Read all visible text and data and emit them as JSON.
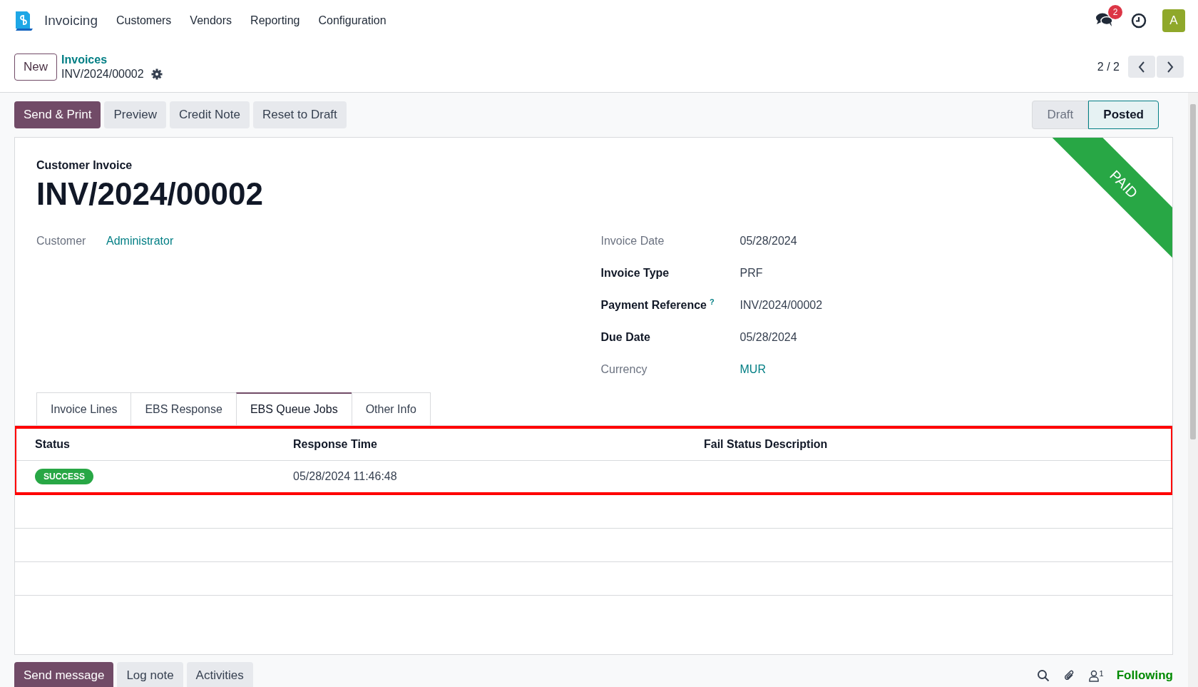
{
  "app_nav": {
    "app_name": "Invoicing",
    "menu": [
      "Customers",
      "Vendors",
      "Reporting",
      "Configuration"
    ],
    "messages_badge": "2",
    "avatar_letter": "A"
  },
  "control_panel": {
    "new_button": "New",
    "breadcrumb_parent": "Invoices",
    "breadcrumb_current": "INV/2024/00002",
    "pager": "2 / 2"
  },
  "actions": [
    {
      "label": "Send & Print",
      "kind": "primary"
    },
    {
      "label": "Preview",
      "kind": "secondary"
    },
    {
      "label": "Credit Note",
      "kind": "secondary"
    },
    {
      "label": "Reset to Draft",
      "kind": "secondary"
    }
  ],
  "status_bar": [
    {
      "label": "Draft",
      "selected": false
    },
    {
      "label": "Posted",
      "selected": true
    }
  ],
  "sheet": {
    "ribbon": "PAID",
    "subtitle": "Customer Invoice",
    "title": "INV/2024/00002",
    "customer": {
      "label": "Customer",
      "value": "Administrator"
    },
    "fields": [
      {
        "label": "Invoice Date",
        "value": "05/28/2024",
        "required": false,
        "link": false
      },
      {
        "label": "Invoice Type",
        "value": "PRF",
        "required": true,
        "link": false
      },
      {
        "label": "Payment Reference",
        "help": "?",
        "value": "INV/2024/00002",
        "required": true,
        "link": false
      },
      {
        "label": "Due Date",
        "value": "05/28/2024",
        "required": true,
        "link": false
      },
      {
        "label": "Currency",
        "value": "MUR",
        "required": false,
        "link": true
      }
    ]
  },
  "tabs": [
    {
      "label": "Invoice Lines",
      "selected": false
    },
    {
      "label": "EBS Response",
      "selected": false
    },
    {
      "label": "EBS Queue Jobs",
      "selected": true
    },
    {
      "label": "Other Info",
      "selected": false
    }
  ],
  "jobs_table": {
    "columns": [
      "Status",
      "Response Time",
      "Fail Status Description"
    ],
    "rows": [
      {
        "status": "SUCCESS",
        "response_time": "05/28/2024 11:46:48"
      }
    ]
  },
  "chatter": {
    "buttons": [
      {
        "label": "Send message",
        "selected": true
      },
      {
        "label": "Log note",
        "selected": false
      },
      {
        "label": "Activities",
        "selected": false
      }
    ],
    "follower_count": "1",
    "follow_label": "Following"
  }
}
